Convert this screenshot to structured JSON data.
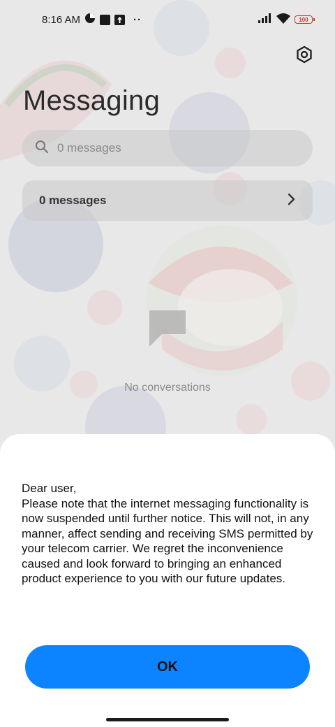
{
  "status_bar": {
    "time": "8:16 AM",
    "battery": "100",
    "icons": [
      "data-saver-icon",
      "square-app-icon",
      "upload-notification-icon",
      "more-dots-icon",
      "signal-icon",
      "wifi-icon",
      "battery-icon"
    ]
  },
  "header": {
    "title": "Messaging",
    "settings_icon": "settings-icon"
  },
  "search": {
    "placeholder": "0 messages"
  },
  "messages_row": {
    "label": "0 messages"
  },
  "empty_state": {
    "text": "No conversations"
  },
  "dialog": {
    "message": "Dear user,\nPlease note that the internet messaging functionality is now suspended until further notice. This will not, in any manner, affect sending and receiving SMS permitted by your telecom carrier. We regret the inconvenience caused and look forward to bringing an enhanced product experience to you with our future updates.",
    "ok_label": "OK"
  },
  "colors": {
    "accent": "#0d84ff",
    "battery": "#c0392b"
  }
}
